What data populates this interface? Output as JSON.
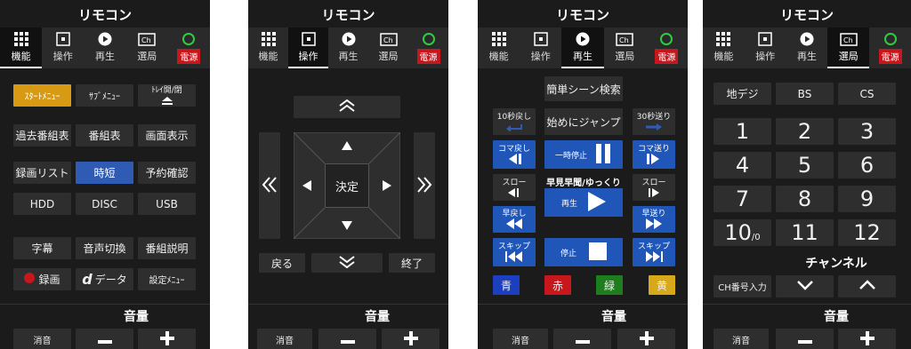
{
  "title": "リモコン",
  "tabs": {
    "func": "機能",
    "op": "操作",
    "play": "再生",
    "ch": "選局",
    "power": "電源"
  },
  "p1": {
    "start_menu": "ｽﾀｰﾄﾒﾆｭｰ",
    "sub_menu": "ｻﾌﾞﾒﾆｭｰ",
    "tray": "ﾄﾚｲ開/閉",
    "past_guide": "過去番組表",
    "guide": "番組表",
    "screen": "画面表示",
    "rec_list": "録画リスト",
    "jitan": "時短",
    "reserve": "予約確認",
    "hdd": "HDD",
    "disc": "DISC",
    "usb": "USB",
    "subtitle": "字幕",
    "audio": "音声切換",
    "program_info": "番組説明",
    "record": "録画",
    "data": "データ",
    "settings": "設定ﾒﾆｭｰ",
    "d_letter": "d"
  },
  "p2": {
    "enter": "決定",
    "back": "戻る",
    "end": "終了"
  },
  "p3": {
    "scene_search": "簡単シーン検索",
    "back10": "10秒戻し",
    "jump_start": "始めにジャンプ",
    "fwd30": "30秒送り",
    "frame_back": "コマ戻し",
    "pause": "一時停止",
    "frame_fwd": "コマ送り",
    "slow_back": "スロー",
    "ff_slow": "早見早聞/ゆっくり",
    "slow_fwd": "スロー",
    "rewind": "早戻し",
    "play": "再生",
    "fast_fwd": "早送り",
    "skip_back": "スキップ",
    "stop": "停止",
    "skip_fwd": "スキップ",
    "blue": "青",
    "red": "赤",
    "green": "緑",
    "yellow": "黄"
  },
  "p4": {
    "terrestrial": "地デジ",
    "bs": "BS",
    "cs": "CS",
    "n1": "1",
    "n2": "2",
    "n3": "3",
    "n4": "4",
    "n5": "5",
    "n6": "6",
    "n7": "7",
    "n8": "8",
    "n9": "9",
    "n10": "10",
    "n10sub": "/0",
    "n11": "11",
    "n12": "12",
    "channel": "チャンネル",
    "ch_input": "CH番号入力"
  },
  "volume": {
    "label": "音量",
    "mute": "消音",
    "minus": "−",
    "plus": "+"
  },
  "colors": {
    "bg": "#1b1b1b",
    "button": "#2e2e2e",
    "accent_orange": "#d99a13",
    "accent_blue": "#2f5bb5",
    "power": "#c8161d"
  }
}
